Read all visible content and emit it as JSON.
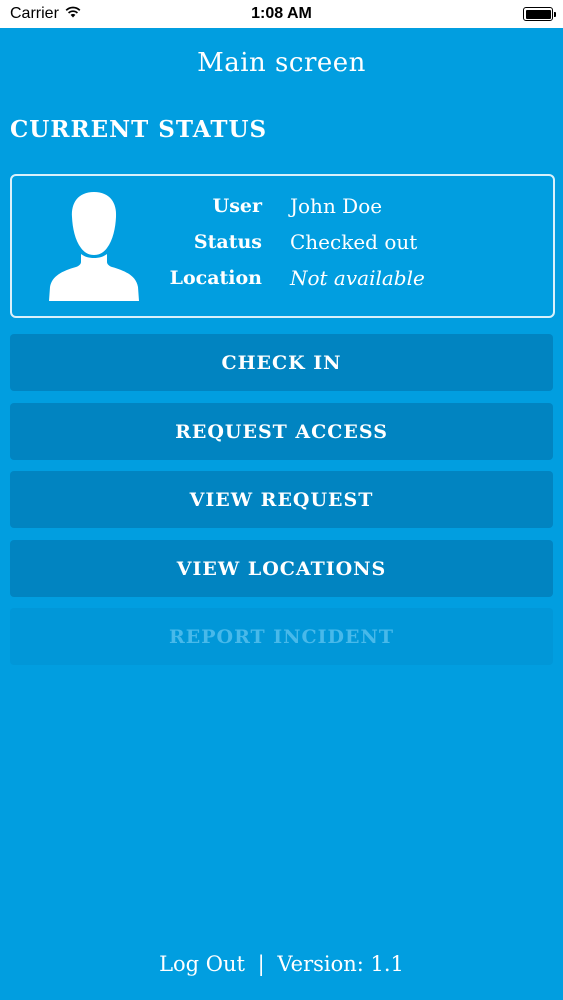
{
  "status_bar": {
    "carrier": "Carrier",
    "time": "1:08 AM",
    "wifi_icon": "wifi-icon",
    "battery_icon": "battery-icon"
  },
  "nav": {
    "title": "Main screen"
  },
  "current_status": {
    "heading": "CURRENT STATUS",
    "avatar_icon": "user-silhouette-icon",
    "rows": [
      {
        "label": "User",
        "value": "John Doe"
      },
      {
        "label": "Status",
        "value": "Checked out"
      },
      {
        "label": "Location",
        "value": "Not available"
      }
    ]
  },
  "actions": {
    "check_in": "CHECK IN",
    "request_access": "REQUEST ACCESS",
    "view_request": "VIEW REQUEST",
    "view_locations": "VIEW LOCATIONS",
    "report_incident": "REPORT INCIDENT"
  },
  "footer": {
    "logout": "Log Out",
    "separator": "|",
    "version": "Version: 1.1"
  },
  "colors": {
    "background": "#019ee0",
    "button": "#0184c1",
    "disabled_text": "#48b9ea"
  }
}
